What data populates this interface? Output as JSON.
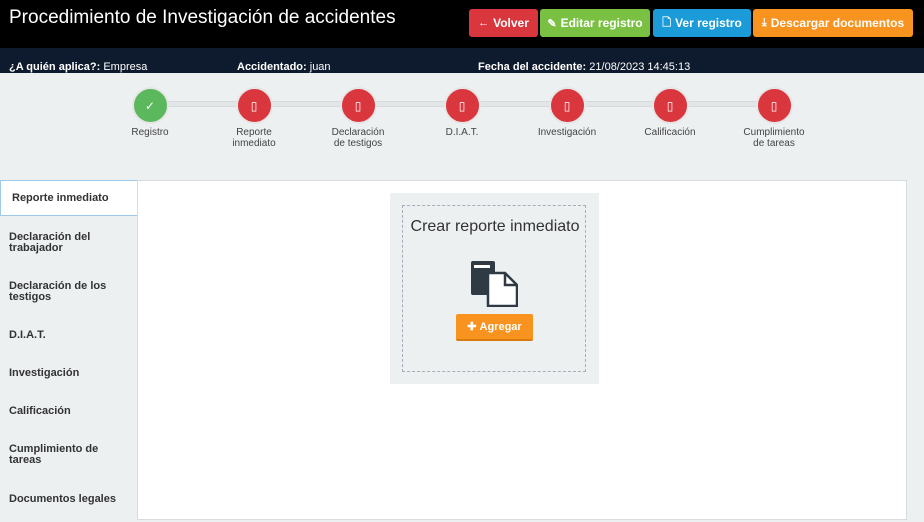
{
  "header": {
    "title": "Procedimiento de Investigación de accidentes",
    "buttons": {
      "volver": "Volver",
      "editar": "Editar registro",
      "ver": "Ver registro",
      "descargar": "Descargar documentos"
    }
  },
  "info": {
    "aplica_label": "¿A quién aplica?:",
    "aplica_value": "Empresa",
    "accidentado_label": "Accidentado:",
    "accidentado_value": "juan",
    "fecha_label": "Fecha del accidente:",
    "fecha_value": "21/08/2023 14:45:13"
  },
  "steps": [
    {
      "label": "Registro",
      "status": "done"
    },
    {
      "label": "Reporte inmediato",
      "status": "pending"
    },
    {
      "label": "Declaración de testigos",
      "status": "pending"
    },
    {
      "label": "D.I.A.T.",
      "status": "pending"
    },
    {
      "label": "Investigación",
      "status": "pending"
    },
    {
      "label": "Calificación",
      "status": "pending"
    },
    {
      "label": "Cumplimiento de tareas",
      "status": "pending"
    }
  ],
  "sidebar": {
    "items": [
      {
        "label": "Reporte inmediato"
      },
      {
        "label": "Declaración del trabajador"
      },
      {
        "label": "Declaración de los testigos"
      },
      {
        "label": "D.I.A.T."
      },
      {
        "label": "Investigación"
      },
      {
        "label": "Calificación"
      },
      {
        "label": "Cumplimiento de tareas"
      },
      {
        "label": "Documentos legales"
      }
    ]
  },
  "card": {
    "title": "Crear reporte inmediato",
    "add_label": "Agregar"
  },
  "colors": {
    "done": "#5cb85c",
    "pending": "#d9363e",
    "accent_orange": "#f7931e"
  }
}
